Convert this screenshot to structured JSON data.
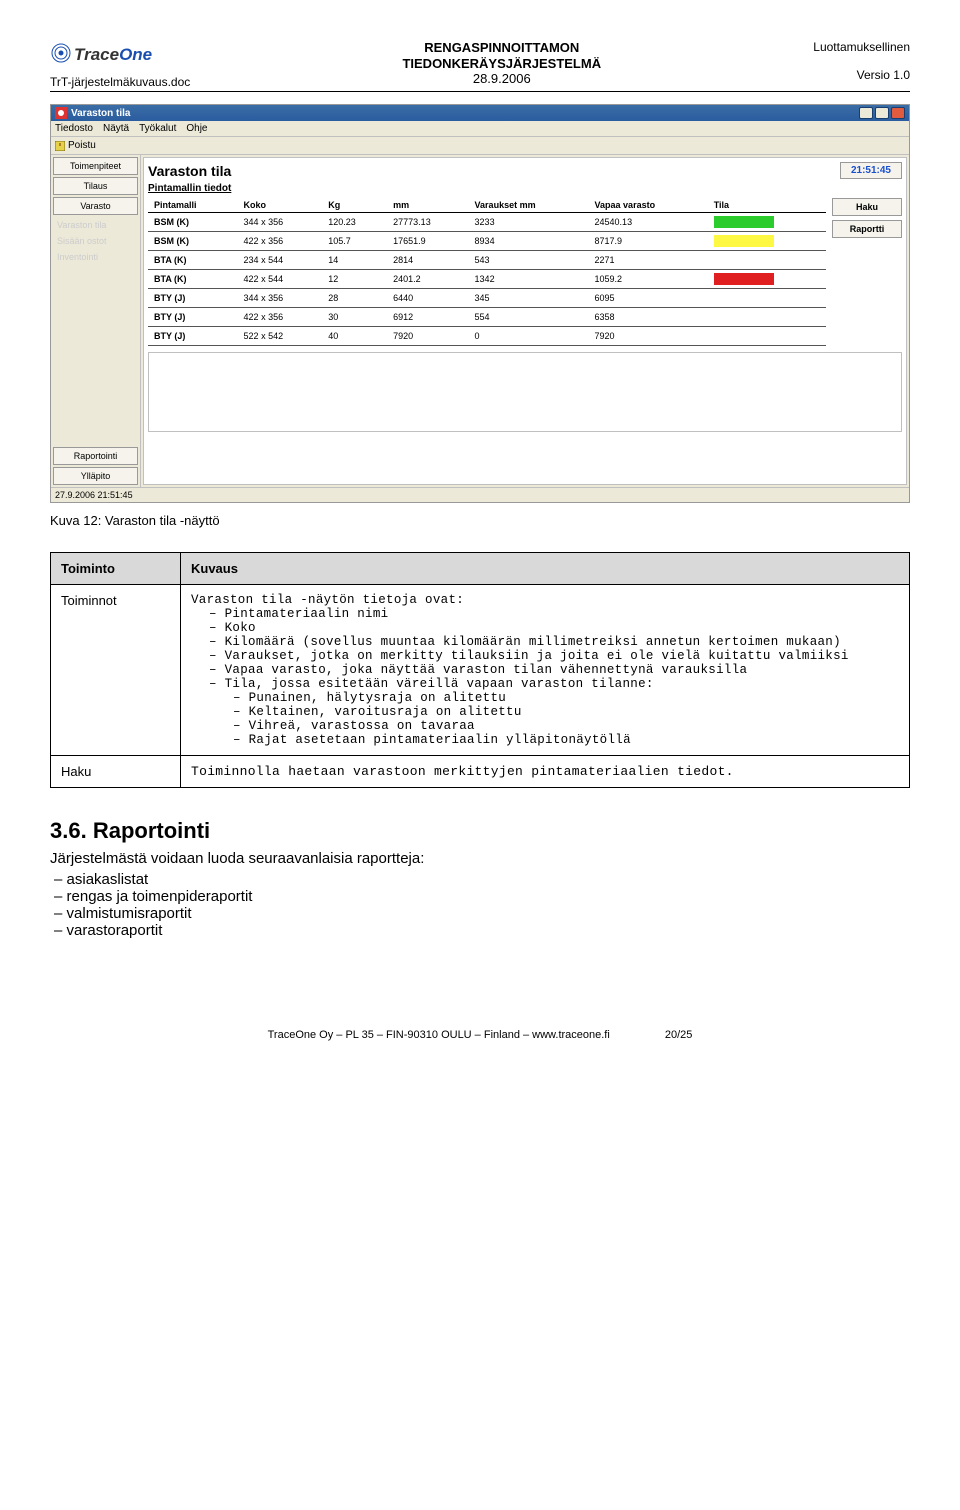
{
  "header": {
    "doc_name": "TrT-järjestelmäkuvaus.doc",
    "title_line1": "RENGASPINNOITTAMON",
    "title_line2": "TIEDONKERÄYSJÄRJESTELMÄ",
    "date": "28.9.2006",
    "confidential": "Luottamuksellinen",
    "version": "Versio 1.0"
  },
  "app": {
    "title": "Varaston tila",
    "menu": [
      "Tiedosto",
      "Näytä",
      "Työkalut",
      "Ohje"
    ],
    "toolbar": {
      "exit": "Poistu"
    },
    "sidebar": {
      "groups": [
        "Toimenpiteet",
        "Tilaus",
        "Varasto"
      ],
      "sub": [
        "Varaston tila",
        "Sisään ostot",
        "Inventointi"
      ],
      "groups2": [
        "Raportointi",
        "Ylläpito"
      ]
    },
    "main": {
      "title": "Varaston tila",
      "clock": "21:51:45",
      "sub": "Pintamallin tiedot",
      "cols": [
        "Pintamalli",
        "Koko",
        "Kg",
        "mm",
        "Varaukset mm",
        "Vapaa varasto",
        "Tila"
      ],
      "rows": [
        {
          "c": [
            "BSM (K)",
            "344 x 356",
            "120.23",
            "27773.13",
            "3233",
            "24540.13"
          ],
          "tila": "green"
        },
        {
          "c": [
            "BSM (K)",
            "422 x 356",
            "105.7",
            "17651.9",
            "8934",
            "8717.9"
          ],
          "tila": "yellow"
        },
        {
          "c": [
            "BTA (K)",
            "234 x 544",
            "14",
            "2814",
            "543",
            "2271"
          ],
          "tila": "none"
        },
        {
          "c": [
            "BTA (K)",
            "422 x 544",
            "12",
            "2401.2",
            "1342",
            "1059.2"
          ],
          "tila": "red"
        },
        {
          "c": [
            "BTY (J)",
            "344 x 356",
            "28",
            "6440",
            "345",
            "6095"
          ],
          "tila": "none"
        },
        {
          "c": [
            "BTY (J)",
            "422 x 356",
            "30",
            "6912",
            "554",
            "6358"
          ],
          "tila": "none"
        },
        {
          "c": [
            "BTY (J)",
            "522 x 542",
            "40",
            "7920",
            "0",
            "7920"
          ],
          "tila": "none"
        }
      ],
      "buttons": [
        "Haku",
        "Raportti"
      ]
    },
    "status": "27.9.2006 21:51:45"
  },
  "caption": "Kuva 12: Varaston tila -näyttö",
  "desc": {
    "head": [
      "Toiminto",
      "Kuvaus"
    ],
    "row1_label": "Toiminnot",
    "row1_intro": "Varaston tila -näytön tietoja ovat:",
    "row1_items": [
      "Pintamateriaalin nimi",
      "Koko",
      "Kilomäärä (sovellus muuntaa kilomäärän millimetreiksi annetun kertoimen mukaan)",
      "Varaukset, jotka on merkitty tilauksiin ja joita ei ole vielä kuitattu valmiiksi",
      "Vapaa varasto, joka näyttää varaston tilan vähennettynä varauksilla"
    ],
    "row1_tila_head": "Tila, jossa esitetään väreillä vapaan varaston tilanne:",
    "row1_tila_items": [
      "Punainen, hälytysraja on alitettu",
      "Keltainen, varoitusraja on alitettu",
      "Vihreä, varastossa on tavaraa",
      "Rajat asetetaan pintamateriaalin ylläpitonäytöllä"
    ],
    "row2_label": "Haku",
    "row2_text": "Toiminnolla haetaan varastoon merkittyjen pintamateriaalien tiedot."
  },
  "sec": {
    "num": "3.6.",
    "title": "Raportointi",
    "intro": "Järjestelmästä voidaan luoda seuraavanlaisia raportteja:",
    "items": [
      "asiakaslistat",
      "rengas ja toimenpideraportit",
      "valmistumisraportit",
      "varastoraportit"
    ]
  },
  "footer": {
    "text": "TraceOne Oy – PL 35 – FIN-90310 OULU – Finland – www.traceone.fi",
    "page": "20/25"
  }
}
